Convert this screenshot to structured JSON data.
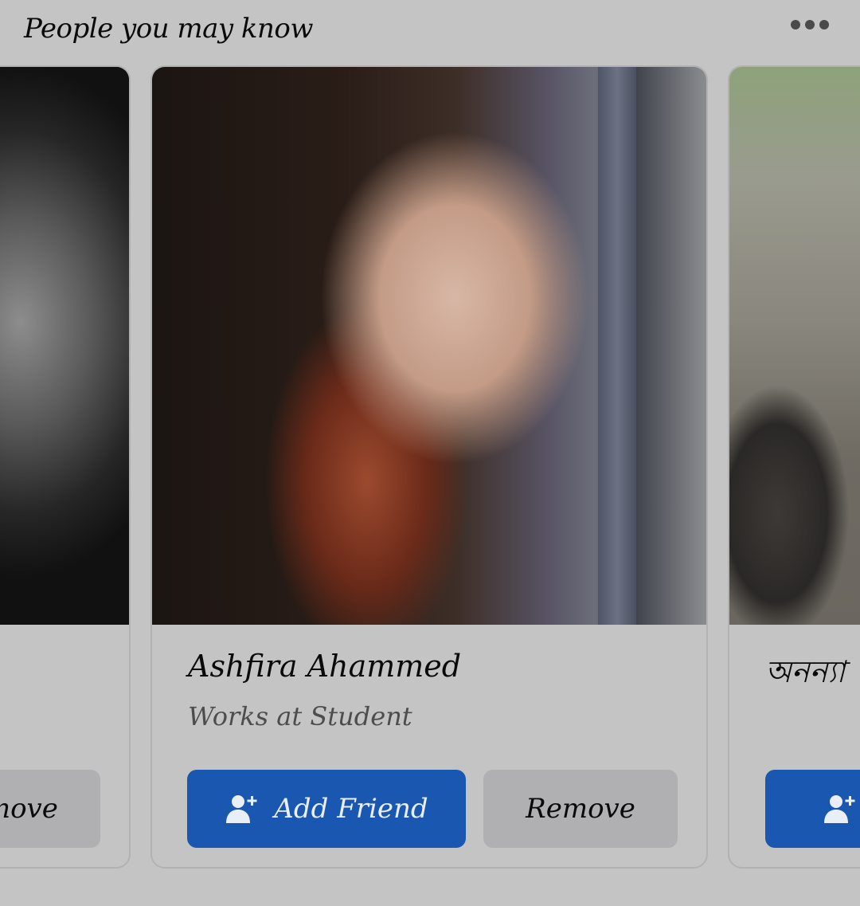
{
  "header": {
    "title": "People you may know",
    "more_icon": "more-horizontal-icon"
  },
  "colors": {
    "accent": "#1a57b0",
    "background": "#c4c4c4",
    "secondary_button": "#b0b0b2"
  },
  "cards": [
    {
      "name": "",
      "subtitle": "",
      "remove_label": "Remove",
      "visible_remove_text": "nove"
    },
    {
      "name": "Ashfira Ahammed",
      "subtitle": "Works at Student",
      "add_label": "Add Friend",
      "remove_label": "Remove",
      "add_icon": "add-person-icon"
    },
    {
      "name": "অনন্যা",
      "visible_name_text": "অনন্যা",
      "add_label": "",
      "add_icon": "add-person-icon"
    }
  ]
}
